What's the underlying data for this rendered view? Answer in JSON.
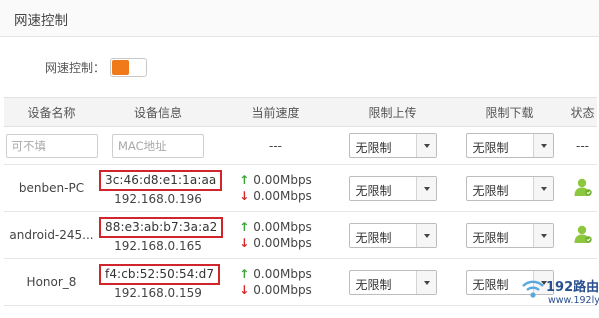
{
  "header": {
    "title": "网速控制"
  },
  "speed_control": {
    "label": "网速控制：",
    "enabled": true,
    "accent_color": "#f07a1a"
  },
  "table": {
    "columns": [
      "设备名称",
      "设备信息",
      "当前速度",
      "限制上传",
      "限制下载",
      "状态"
    ],
    "filter": {
      "name_placeholder": "可不填",
      "mac_placeholder": "MAC地址",
      "speed": "---",
      "upload": "无限制",
      "download": "无限制",
      "status": "---"
    },
    "rows": [
      {
        "name": "benben-PC",
        "mac": "3c:46:d8:e1:1a:aa",
        "ip": "192.168.0.196",
        "up_speed": "0.00Mbps",
        "down_speed": "0.00Mbps",
        "upload": "无限制",
        "download": "无限制",
        "status_icon": "user-online-icon"
      },
      {
        "name": "android-245...",
        "mac": "88:e3:ab:b7:3a:a2",
        "ip": "192.168.0.165",
        "up_speed": "0.00Mbps",
        "down_speed": "0.00Mbps",
        "upload": "无限制",
        "download": "无限制",
        "status_icon": "user-online-icon"
      },
      {
        "name": "Honor_8",
        "mac": "f4:cb:52:50:54:d7",
        "ip": "192.168.0.159",
        "up_speed": "0.00Mbps",
        "down_speed": "0.00Mbps",
        "upload": "无限制",
        "download": "无限制",
        "status_icon": "user-online-icon"
      }
    ],
    "highlight_color": "#d0262b",
    "up_arrow": "↑",
    "down_arrow": "↓",
    "up_color": "#3aa53a",
    "down_color": "#d12b2b"
  },
  "watermark": {
    "brand": "192路由网",
    "url": "www.192ly.com",
    "icon": "wifi-icon"
  }
}
